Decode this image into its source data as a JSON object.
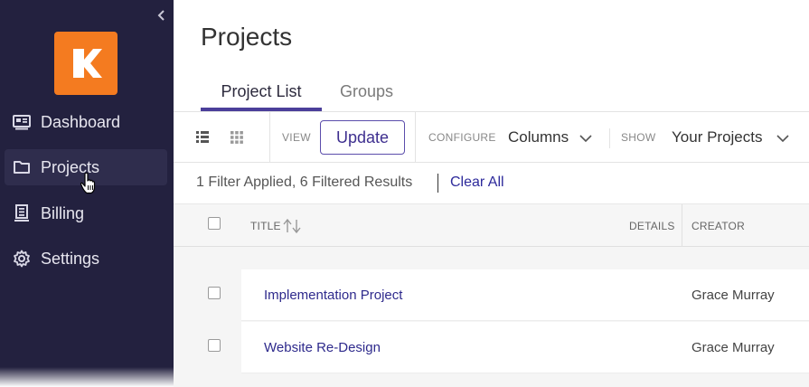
{
  "app": {
    "brand_color": "#f47b20",
    "sidebar_bg": "#23213f",
    "accent": "#4b3f9a"
  },
  "sidebar": {
    "collapse_icon": "chevron-left-icon",
    "logo_icon": "k-logo",
    "items": [
      {
        "label": "Dashboard",
        "icon": "dashboard-icon",
        "active": false
      },
      {
        "label": "Projects",
        "icon": "folder-icon",
        "active": true
      },
      {
        "label": "Billing",
        "icon": "billing-icon",
        "active": false
      },
      {
        "label": "Settings",
        "icon": "gear-icon",
        "active": false
      }
    ]
  },
  "page": {
    "title": "Projects"
  },
  "tabs": [
    {
      "label": "Project List",
      "active": true
    },
    {
      "label": "Groups",
      "active": false
    }
  ],
  "toolbar": {
    "view_label": "VIEW",
    "update_label": "Update",
    "configure_label": "CONFIGURE",
    "columns_value": "Columns",
    "show_label": "SHOW",
    "show_value": "Your Projects"
  },
  "filter": {
    "summary": "1 Filter Applied, 6 Filtered Results",
    "clear_label": "Clear All"
  },
  "table": {
    "columns": [
      "TITLE",
      "DETAILS",
      "CREATOR"
    ],
    "rows": [
      {
        "title": "Implementation Project",
        "creator": "Grace Murray"
      },
      {
        "title": "Website Re-Design",
        "creator": "Grace Murray"
      }
    ]
  }
}
